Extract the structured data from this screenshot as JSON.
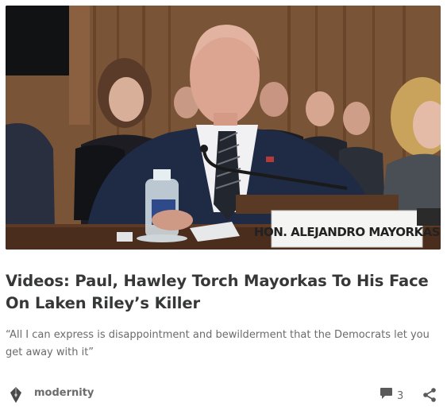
{
  "post": {
    "title": "Videos: Paul, Hawley Torch Mayorkas To His Face On Laken Riley’s Killer",
    "subtitle": "“All I can express is disappointment and bewilderment that the Democrats let you get away with it”",
    "image": {
      "nameplate_text": "HON. ALEJANDRO MAYORKAS"
    },
    "author": {
      "name": "modernity",
      "avatar_icon": "pen-nib-icon"
    },
    "comments": {
      "icon": "comment-bubble-icon",
      "count": "3"
    },
    "share_icon": "share-icon"
  },
  "colors": {
    "text": "#363737",
    "muted": "#6b6b6b",
    "background": "#ffffff"
  }
}
